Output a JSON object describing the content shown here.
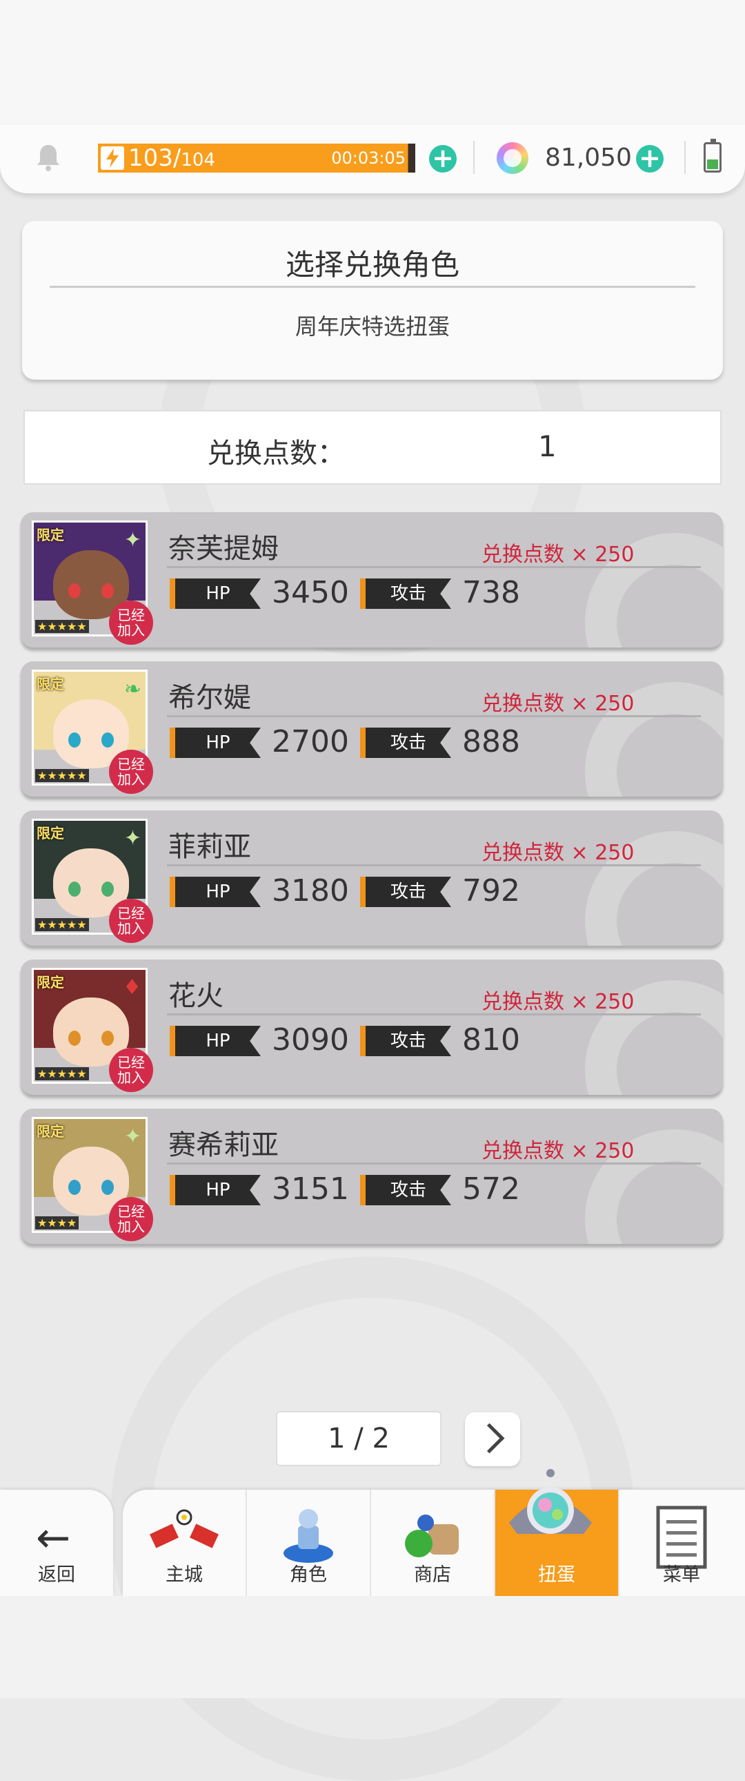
{
  "hud": {
    "stamina_current": "103/",
    "stamina_max": "104",
    "stamina_fraction": 0.99,
    "timer": "00:03:05",
    "gems": "81,050"
  },
  "header": {
    "title": "选择兑换角色",
    "subtitle": "周年庆特选扭蛋"
  },
  "points": {
    "label": "兑换点数：",
    "value": "1"
  },
  "characters": [
    {
      "name": "奈芙提姆",
      "cost": "兑换点数 × 250",
      "hp": "3450",
      "atk": "738",
      "hair": "#4b2a6e",
      "skin": "#8a5a40",
      "eye": "#e04040",
      "element": "✦",
      "element_color": "#c8e8a0",
      "stars": "★★★★★"
    },
    {
      "name": "希尔媞",
      "cost": "兑换点数 × 250",
      "hp": "2700",
      "atk": "888",
      "hair": "#f0dca0",
      "skin": "#fbe3cf",
      "eye": "#2aa8c8",
      "element": "❧",
      "element_color": "#3fbf5a",
      "stars": "★★★★★"
    },
    {
      "name": "菲莉亚",
      "cost": "兑换点数 × 250",
      "hp": "3180",
      "atk": "792",
      "hair": "#2e3a34",
      "skin": "#f6dcc8",
      "eye": "#4caf70",
      "element": "✦",
      "element_color": "#c8e8a0",
      "stars": "★★★★★"
    },
    {
      "name": "花火",
      "cost": "兑换点数 × 250",
      "hp": "3090",
      "atk": "810",
      "hair": "#7a2c2c",
      "skin": "#f6d8c0",
      "eye": "#e0902a",
      "element": "♦",
      "element_color": "#e03a3a",
      "stars": "★★★★★"
    },
    {
      "name": "赛希莉亚",
      "cost": "兑换点数 × 250",
      "hp": "3151",
      "atk": "572",
      "hair": "#b8a060",
      "skin": "#f7dcc8",
      "eye": "#30a0c8",
      "element": "✦",
      "element_color": "#c8e8a0",
      "stars": "★★★★"
    }
  ],
  "labels": {
    "hp": "HP",
    "atk": "攻击",
    "limited": "限定",
    "joined_1": "已经",
    "joined_2": "加入"
  },
  "pager": {
    "text": "1 / 2"
  },
  "nav": {
    "back": "返回",
    "items": [
      {
        "label": "主城",
        "icon": "castle-icon"
      },
      {
        "label": "角色",
        "icon": "character-icon"
      },
      {
        "label": "商店",
        "icon": "shop-icon"
      },
      {
        "label": "扭蛋",
        "icon": "gacha-icon",
        "active": true
      },
      {
        "label": "菜单",
        "icon": "menu-icon"
      }
    ]
  },
  "colors": {
    "accent": "#f79c1b",
    "cost_red": "#d0253c",
    "plus_teal": "#2ec4a6"
  }
}
